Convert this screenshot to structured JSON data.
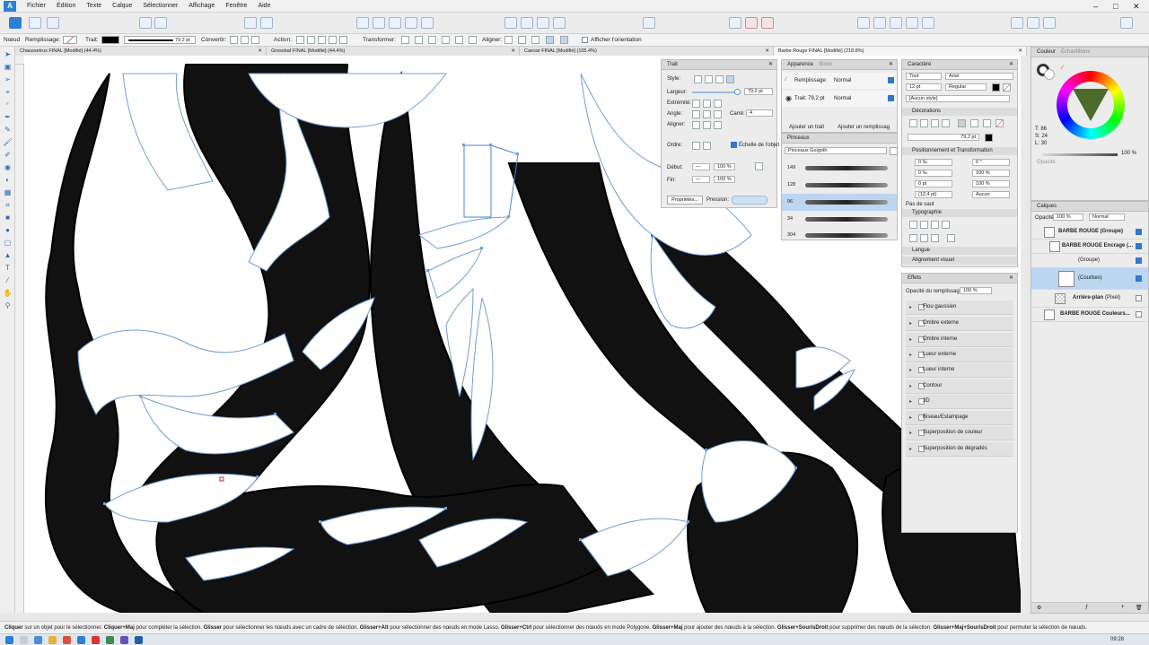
{
  "app": {
    "logo_letter": "A"
  },
  "menubar": {
    "items": [
      "Fichier",
      "Édition",
      "Texte",
      "Calque",
      "Sélectionner",
      "Affichage",
      "Fenêtre",
      "Aide"
    ]
  },
  "context_toolbar": {
    "node_label": "Nœud",
    "fill_label": "Remplissage:",
    "stroke_label": "Trait:",
    "stroke_width": "79,2 pt",
    "convert_label": "Convertir:",
    "action_label": "Action:",
    "transform_label": "Transformer:",
    "align_label": "Aligner:",
    "show_orientation_label": "Afficher l'orientation"
  },
  "doc_tabs": [
    {
      "title": "Chaussetrus FINAL [Modifié] (44.4%)"
    },
    {
      "title": "Grossbaf FINAL [Modifié] (44.4%)"
    },
    {
      "title": "Caesar FINAL [Modifié] (105.4%)"
    },
    {
      "title": "Barbe Rouge FINAL [Modifié] (218.8%)"
    }
  ],
  "stroke_panel": {
    "title": "Trait",
    "style_label": "Style:",
    "width_label": "Largeur:",
    "width_value": "79,2 pt",
    "width_slider": 0.96,
    "cap_label": "Extrémité:",
    "join_label": "Angle:",
    "miter_label": "Carré:",
    "miter_value": "4",
    "align_label": "Aligner:",
    "order_label": "Ordre:",
    "scale_label": "Échelle de l'objet",
    "start_label": "Début:",
    "end_label": "Fin:",
    "start_pct": "100 %",
    "end_pct": "100 %",
    "properties_button": "Propriétés...",
    "pressure_label": "Pression:"
  },
  "appearance_panel": {
    "tab1": "Apparence",
    "tab2": "Stock",
    "fill_row_label": "Remplissage:",
    "fill_row_mode": "Normal",
    "stroke_row_label": "Trait: 79,2 pt",
    "stroke_row_mode": "Normal",
    "add_stroke_button": "Ajouter un trait",
    "add_fill_button": "Ajouter un remplissag"
  },
  "brushes_panel": {
    "title": "Pinceaux",
    "category": "Pinceaux Goigoth",
    "brushes": [
      {
        "size": "149"
      },
      {
        "size": "128"
      },
      {
        "size": "96"
      },
      {
        "size": "34"
      },
      {
        "size": "304"
      }
    ],
    "selected_index": 2
  },
  "character_panel": {
    "title": "Caractère",
    "scope": "Tout",
    "font": "Arial",
    "size": "12 pt",
    "weight": "Regular",
    "style_preset": "[Aucun style]",
    "decorations_label": "Décorations",
    "deco_width": "79,2 pt",
    "pos_transform_label": "Positionnement et Transformation",
    "vals": [
      "0 ‰",
      "0 °",
      "0 ‰",
      "100 %",
      "0 pt",
      "100 %",
      "(12,4 pt)",
      "Aucun"
    ],
    "no_break_label": "Pas de saut",
    "typography_label": "Typographie",
    "language_label": "Langue",
    "visual_align_label": "Alignement visuel"
  },
  "effects_panel": {
    "title": "Effets",
    "opacity_label": "Opacité du remplissage:",
    "opacity_value": "100 %",
    "effects": [
      "Flou gaussien",
      "Ombre externe",
      "Ombre interne",
      "Lueur externe",
      "Lueur interne",
      "Contour",
      "3D",
      "Biseau/Estampage",
      "Superposition de couleur",
      "Superposition de dégradés"
    ]
  },
  "color_panel": {
    "tab1": "Couleur",
    "tab2": "Échantillons",
    "T": "T: 86",
    "S": "S: 24",
    "L": "L: 30",
    "opacity_label": "Opacité",
    "opacity_value": "100 %",
    "accent": "#2f78d0"
  },
  "layers_panel": {
    "title": "Calques",
    "opacity_label": "Opacité:",
    "opacity_value": "100 %",
    "blend": "Normal",
    "layers": [
      {
        "name": "BARBE ROUGE (Groupe)"
      },
      {
        "name": "BARBE ROUGE Encrage (..."
      },
      {
        "name": "(Groupe)"
      },
      {
        "name": "(Courbes)"
      },
      {
        "name": "Arrière-plan",
        "suffix": "(Pixel)"
      },
      {
        "name": "BARBE ROUGE Couleurs..."
      }
    ]
  },
  "status_bar": {
    "parts": [
      {
        "b": "Cliquer",
        "t": " sur un objet pour le sélectionner. "
      },
      {
        "b": "Cliquer+Maj",
        "t": " pour compléter la sélection. "
      },
      {
        "b": "Glisser",
        "t": " pour sélectionner les nœuds avec un cadre de sélection. "
      },
      {
        "b": "Glisser+Alt",
        "t": " pour sélectionner des nœuds en mode Lasso. "
      },
      {
        "b": "Glisser+Ctrl",
        "t": " pour sélectionner des nœuds en mode Polygone. "
      },
      {
        "b": "Glisser+Maj",
        "t": " pour ajouter des nœuds à la sélection. "
      },
      {
        "b": "Glisser+SourisDroit",
        "t": " pour supprimer des nœuds de la sélection. "
      },
      {
        "b": "Glisser+Maj+SourisDroit",
        "t": " pour permuter la sélection de nœuds."
      }
    ]
  },
  "taskbar": {
    "time": "09:28"
  }
}
